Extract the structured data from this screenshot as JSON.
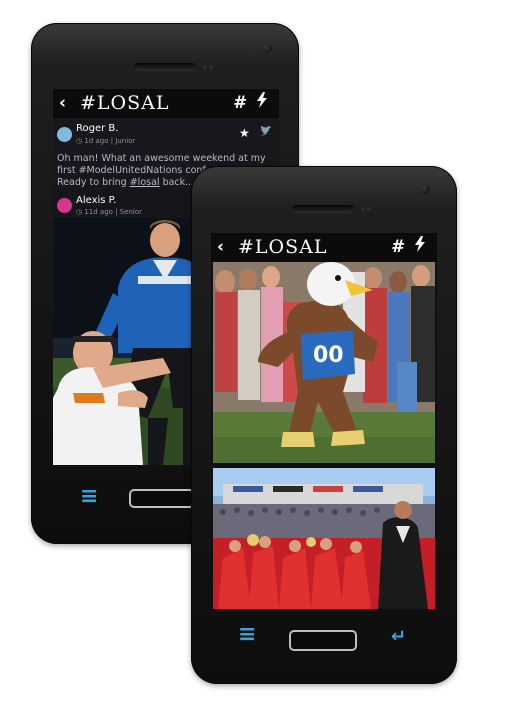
{
  "app": {
    "title": "#LOSAL",
    "hashtag_icon": "#",
    "bolt_icon": "⚡",
    "back_icon": "‹"
  },
  "back_phone": {
    "posts": [
      {
        "author": "Roger B.",
        "time": "1d ago",
        "role": "Junior",
        "text_line1": "Oh man! What an awesome weekend at my",
        "text_line2": "first #ModelUnitedNations conf",
        "text_line3_prefix": "Ready to bring ",
        "text_link": "#losal",
        "text_line3_suffix": " back...",
        "avatar_color": "#7fbcd8"
      },
      {
        "author": "Alexis P.",
        "time": "11d ago",
        "role": "Senior",
        "avatar_color": "#d6378b"
      }
    ]
  },
  "nav": {
    "menu_icon": "≡",
    "return_icon": "↵"
  },
  "colors": {
    "accent": "#2ea6df",
    "header_bg": "#0b0b0c"
  }
}
